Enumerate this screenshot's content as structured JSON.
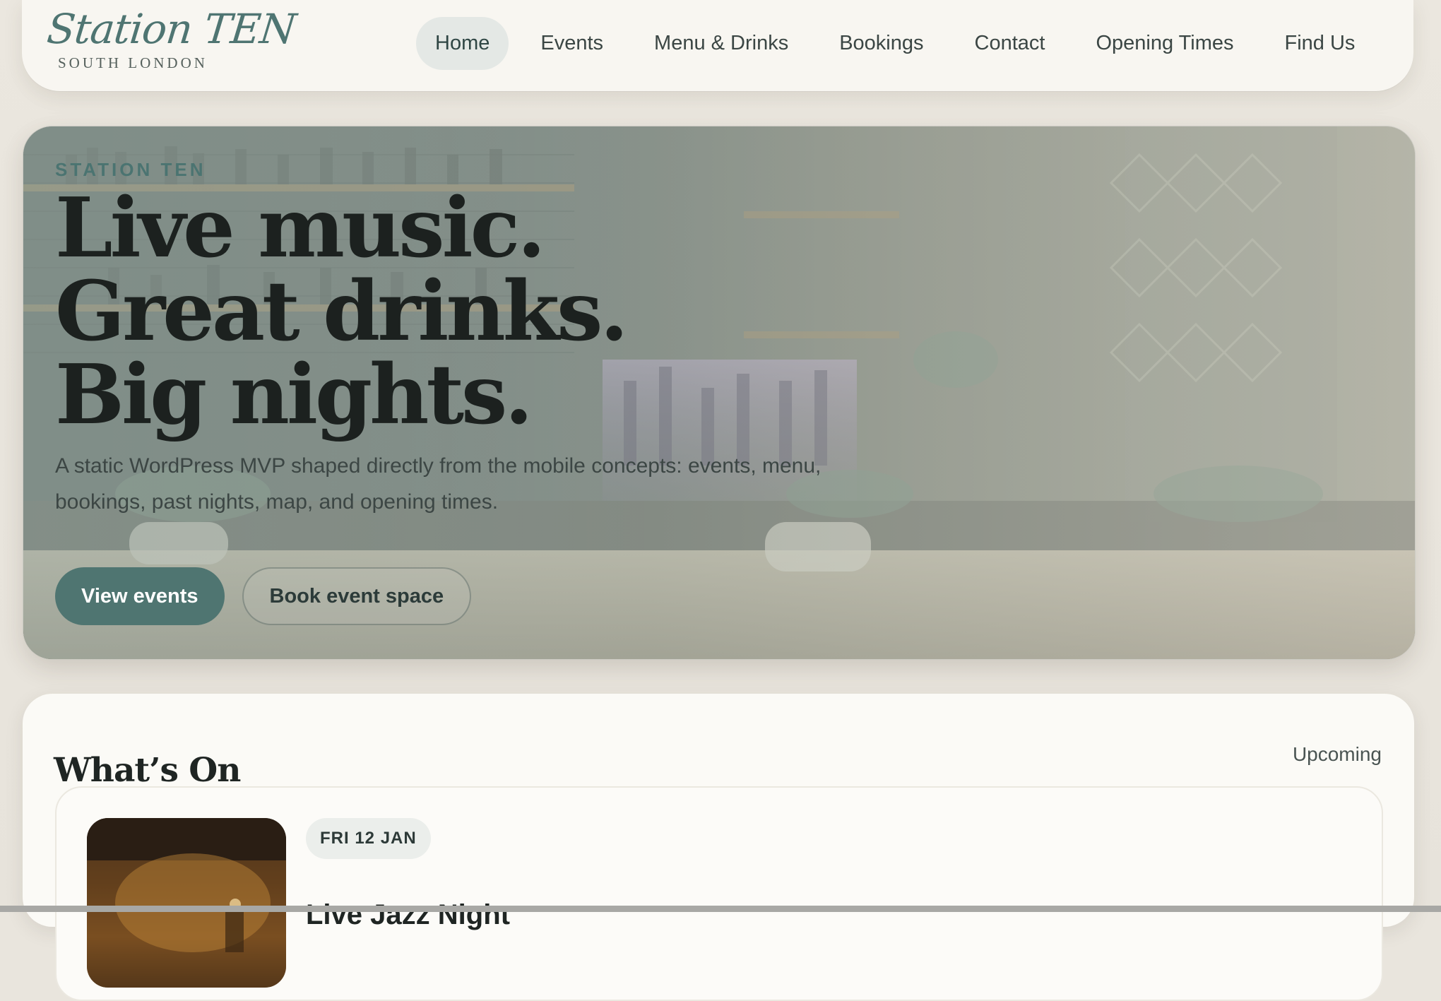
{
  "brand": {
    "name": "Station TEN",
    "tagline": "SOUTH LONDON"
  },
  "nav": {
    "items": [
      {
        "label": "Home",
        "active": true
      },
      {
        "label": "Events",
        "active": false
      },
      {
        "label": "Menu & Drinks",
        "active": false
      },
      {
        "label": "Bookings",
        "active": false
      },
      {
        "label": "Contact",
        "active": false
      },
      {
        "label": "Opening Times",
        "active": false
      },
      {
        "label": "Find Us",
        "active": false
      }
    ]
  },
  "hero": {
    "eyebrow": "STATION TEN",
    "headline": [
      "Live music.",
      "Great drinks.",
      "Big nights."
    ],
    "lede": "A static WordPress MVP shaped directly from the mobile concepts: events, menu, bookings, past nights, map, and opening times.",
    "primary_cta": "View events",
    "secondary_cta": "Book event space"
  },
  "whats_on": {
    "title": "What’s On",
    "link": "Upcoming",
    "events": [
      {
        "date": "FRI 12 JAN",
        "title": "Live Jazz Night"
      }
    ]
  },
  "colors": {
    "accent": "#4f7571",
    "background": "#e9e5dd",
    "surface": "#f8f6f1",
    "text": "#1f2523"
  }
}
